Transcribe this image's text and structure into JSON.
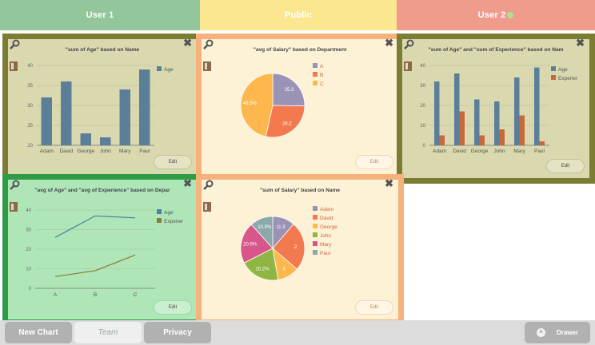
{
  "tabs": [
    {
      "label": "User 1"
    },
    {
      "label": "Public"
    },
    {
      "label": "User 2"
    }
  ],
  "colors": {
    "accent_olive": "#7b7d33",
    "accent_orange": "#f6b27a",
    "accent_green": "#2e9c45",
    "series_blue": "#5b7f99",
    "series_orange": "#c8693c"
  },
  "edit_label": "Edit",
  "bottombar": {
    "new_chart": "New Chart",
    "team": "Team",
    "privacy": "Privacy",
    "drawer": "Drawer"
  },
  "chart_data": [
    {
      "type": "bar",
      "title": "\"sum of Age\" based on Name",
      "categories": [
        "Adam",
        "David",
        "George",
        "John",
        "Mary",
        "Paul"
      ],
      "series": [
        {
          "name": "Age",
          "values": [
            32,
            36,
            23,
            22,
            34,
            39
          ]
        }
      ],
      "yticks": [
        "20",
        "25",
        "30",
        "35",
        "40"
      ],
      "ylim": [
        20,
        40
      ]
    },
    {
      "type": "pie",
      "title": "\"avg of Salary\" based on Department",
      "labels": [
        "A",
        "B",
        "C"
      ],
      "values": [
        25.3,
        28.2,
        46.5
      ],
      "slice_labels": [
        "25.3",
        "28.2",
        "46.5%"
      ],
      "colors": [
        "#9b93b6",
        "#f27a4e",
        "#fdb74d"
      ]
    },
    {
      "type": "bar",
      "title": "\"sum of Age\" and \"sum of Experience\" based on Nam",
      "categories": [
        "Adam",
        "David",
        "George",
        "John",
        "Mary",
        "Paul"
      ],
      "series": [
        {
          "name": "Age",
          "values": [
            32,
            36,
            23,
            22,
            34,
            39
          ]
        },
        {
          "name": "Experier",
          "values": [
            5,
            17,
            5,
            8,
            15,
            2
          ]
        }
      ],
      "yticks": [
        "0",
        "10",
        "20",
        "30",
        "40"
      ],
      "ylim": [
        0,
        40
      ]
    },
    {
      "type": "line",
      "title": "\"avg of Age\" and \"avg of Experience\" based on Depar",
      "categories": [
        "A",
        "B",
        "C"
      ],
      "series": [
        {
          "name": "Age",
          "values": [
            26,
            37,
            36
          ]
        },
        {
          "name": "Experier",
          "values": [
            6,
            9,
            17
          ]
        }
      ],
      "yticks": [
        "0",
        "10",
        "20",
        "30",
        "40"
      ],
      "ylim": [
        0,
        40
      ]
    },
    {
      "type": "pie",
      "title": "\"sum of Salary\" based on Name",
      "labels": [
        "Adam",
        "David",
        "George",
        "John",
        "Mary",
        "Paul"
      ],
      "values": [
        11.3,
        25,
        11,
        20.2,
        20.9,
        11.6
      ],
      "slice_labels": [
        "11.3",
        "2",
        "1",
        "20.2%",
        "20.9%",
        "10.9%"
      ],
      "colors": [
        "#9b93b6",
        "#f27a4e",
        "#fdb74d",
        "#8fb642",
        "#d8568a",
        "#8aa9a8"
      ]
    }
  ]
}
